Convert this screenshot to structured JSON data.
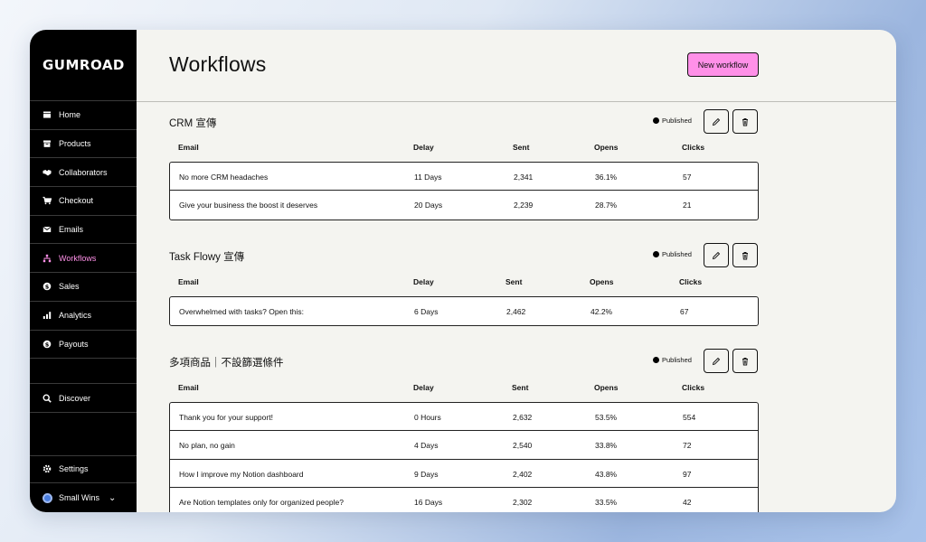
{
  "app": {
    "logo": "GUMROAD"
  },
  "sidebar": {
    "items": [
      {
        "label": "Home",
        "icon": "home-icon"
      },
      {
        "label": "Products",
        "icon": "archive-icon"
      },
      {
        "label": "Collaborators",
        "icon": "handshake-icon"
      },
      {
        "label": "Checkout",
        "icon": "cart-icon"
      },
      {
        "label": "Emails",
        "icon": "envelope-icon"
      },
      {
        "label": "Workflows",
        "icon": "diagram-icon",
        "active": true
      },
      {
        "label": "Sales",
        "icon": "dollar-circle-icon"
      },
      {
        "label": "Analytics",
        "icon": "bar-chart-icon"
      },
      {
        "label": "Payouts",
        "icon": "bank-icon"
      }
    ],
    "discover": "Discover",
    "settings": "Settings",
    "account": "Small Wins"
  },
  "header": {
    "title": "Workflows",
    "new_button": "New workflow"
  },
  "columns": {
    "email": "Email",
    "delay": "Delay",
    "sent": "Sent",
    "opens": "Opens",
    "clicks": "Clicks"
  },
  "workflows": [
    {
      "title": "CRM 宣傳",
      "status": "Published",
      "rows": [
        {
          "email": "No more CRM headaches",
          "delay": "11 Days",
          "sent": "2,341",
          "opens": "36.1%",
          "clicks": "57"
        },
        {
          "email": "Give your business the boost it deserves",
          "delay": "20 Days",
          "sent": "2,239",
          "opens": "28.7%",
          "clicks": "21"
        }
      ]
    },
    {
      "title": "Task Flowy 宣傳",
      "status": "Published",
      "rows": [
        {
          "email": "Overwhelmed with tasks? Open this:",
          "delay": "6 Days",
          "sent": "2,462",
          "opens": "42.2%",
          "clicks": "67"
        }
      ]
    },
    {
      "title": "多項商品｜不設篩選條件",
      "status": "Published",
      "rows": [
        {
          "email": "Thank you for your support!",
          "delay": "0 Hours",
          "sent": "2,632",
          "opens": "53.5%",
          "clicks": "554"
        },
        {
          "email": "No plan, no gain",
          "delay": "4 Days",
          "sent": "2,540",
          "opens": "33.8%",
          "clicks": "72"
        },
        {
          "email": "How I improve my Notion dashboard",
          "delay": "9 Days",
          "sent": "2,402",
          "opens": "43.8%",
          "clicks": "97"
        },
        {
          "email": "Are Notion templates only for organized people?",
          "delay": "16 Days",
          "sent": "2,302",
          "opens": "33.5%",
          "clicks": "42"
        }
      ]
    }
  ]
}
